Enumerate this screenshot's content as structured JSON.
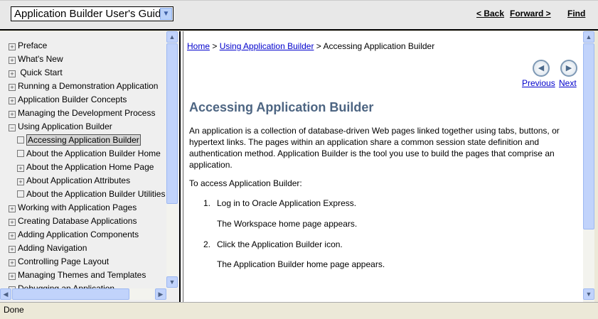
{
  "toolbar": {
    "guide_select": "Application Builder User's Guide",
    "back": "< Back",
    "forward": "Forward >",
    "find": "Find"
  },
  "tree": [
    {
      "label": "Preface",
      "icon": "plus",
      "level": 0
    },
    {
      "label": "What's New",
      "icon": "plus",
      "level": 0
    },
    {
      "label": " Quick Start",
      "icon": "plus",
      "level": 0
    },
    {
      "label": "Running a Demonstration Application",
      "icon": "plus",
      "level": 0
    },
    {
      "label": "Application Builder Concepts",
      "icon": "plus",
      "level": 0
    },
    {
      "label": "Managing the Development Process",
      "icon": "plus",
      "level": 0
    },
    {
      "label": "Using Application Builder",
      "icon": "minus",
      "level": 0
    },
    {
      "label": "Accessing Application Builder",
      "icon": "leaf",
      "level": 1,
      "selected": true
    },
    {
      "label": "About the Application Builder Home",
      "icon": "leaf",
      "level": 1
    },
    {
      "label": "About the Application Home Page",
      "icon": "plus",
      "level": 1
    },
    {
      "label": "About Application Attributes",
      "icon": "plus",
      "level": 1
    },
    {
      "label": "About the Application Builder Utilities",
      "icon": "leaf",
      "level": 1
    },
    {
      "label": "Working with Application Pages",
      "icon": "plus",
      "level": 0
    },
    {
      "label": "Creating Database Applications",
      "icon": "plus",
      "level": 0
    },
    {
      "label": "Adding Application Components",
      "icon": "plus",
      "level": 0
    },
    {
      "label": "Adding Navigation",
      "icon": "plus",
      "level": 0
    },
    {
      "label": "Controlling Page Layout",
      "icon": "plus",
      "level": 0
    },
    {
      "label": "Managing Themes and Templates",
      "icon": "plus",
      "level": 0
    },
    {
      "label": "Debugging an Application",
      "icon": "plus",
      "level": 0
    }
  ],
  "content": {
    "breadcrumb": {
      "home": "Home",
      "sep1": " > ",
      "using": "Using Application Builder",
      "sep2": " > ",
      "current": "Accessing Application Builder"
    },
    "previous": "Previous",
    "next": "Next",
    "title": "Accessing Application Builder",
    "intro": "An application is a collection of database-driven Web pages linked together using tabs, buttons, or hypertext links. The pages within an application share a common session state definition and authentication method. Application Builder is the tool you use to build the pages that comprise an application.",
    "lead": "To access Application Builder:",
    "steps": [
      {
        "num": "1.",
        "text": "Log in to Oracle Application Express.",
        "result": "The Workspace home page appears."
      },
      {
        "num": "2.",
        "text": "Click the Application Builder icon.",
        "result": "The Application Builder home page appears."
      }
    ]
  },
  "status": "Done"
}
